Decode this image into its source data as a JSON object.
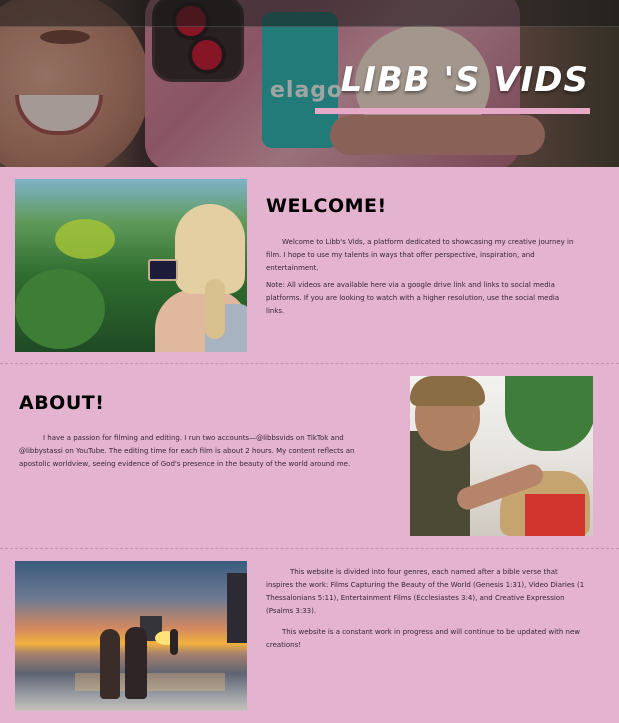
{
  "header": {
    "site_title": "LIBB 'S VIDS"
  },
  "welcome": {
    "heading": "WELCOME!",
    "intro": "Welcome to Libb's Vids, a platform dedicated to showcasing my creative journey in film. I hope to use my talents in ways that offer perspective, inspiration, and entertainment.",
    "note": "Note: All videos are available here via a google drive link and links to social media platforms. If you are looking to watch with a higher resolution, use the social media links."
  },
  "about": {
    "heading": "ABOUT!",
    "text": "I have a passion for filming and editing. I run two accounts—@libbsvids on TikTok and @libbystassi on YouTube. The editing time for each film is about 2 hours. My content reflects an apostolic worldview, seeing evidence of God's presence in the beauty of the world around me."
  },
  "genres": {
    "text": "This website is divided into four genres, each named after a bible verse that inspires the work: Films Capturing the Beauty of the World (Genesis 1:31), Video Diaries (1 Thessalonians 5:11), Entertainment Films (Ecclesiastes 3:4), and Creative Expression (Psalms 3:33).",
    "progress_note": "This website is a constant work in progress and will continue to be updated with new creations!"
  },
  "colors": {
    "page_background": "#e3b3d0",
    "accent_underline": "#e7a9c8",
    "heading_text": "#000000",
    "title_text": "#ffffff"
  },
  "icons": {
    "hero_card_brand": "elago"
  }
}
